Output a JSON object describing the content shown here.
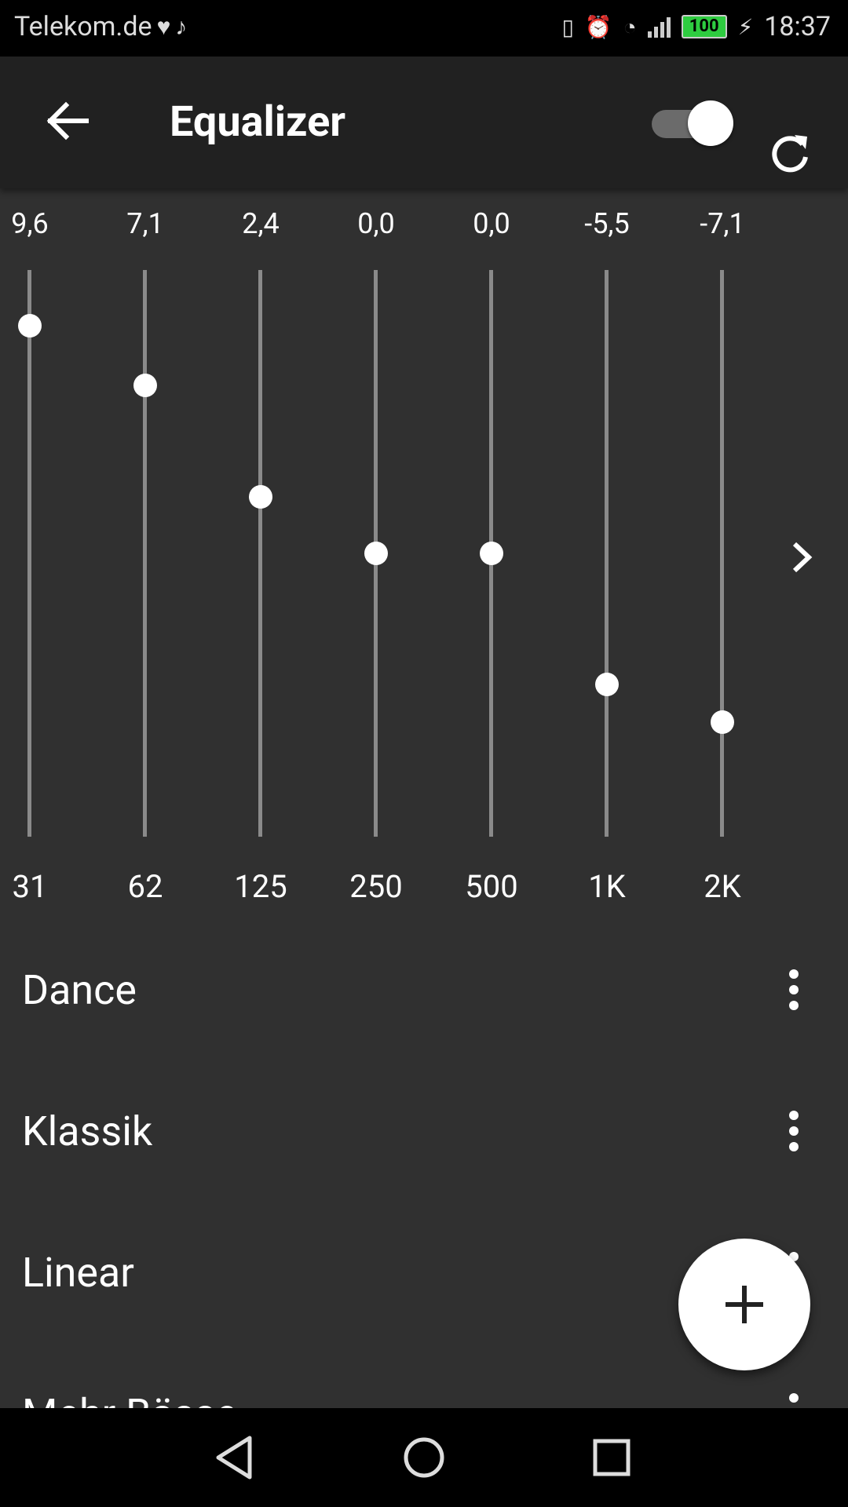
{
  "status_bar": {
    "carrier": "Telekom.de",
    "battery": "100",
    "time": "18:37"
  },
  "app_bar": {
    "title": "Equalizer",
    "toggle_on": true
  },
  "equalizer": {
    "bands": [
      {
        "value": "9,6",
        "freq": "31",
        "level": 9.6
      },
      {
        "value": "7,1",
        "freq": "62",
        "level": 7.1
      },
      {
        "value": "2,4",
        "freq": "125",
        "level": 2.4
      },
      {
        "value": "0,0",
        "freq": "250",
        "level": 0.0
      },
      {
        "value": "0,0",
        "freq": "500",
        "level": 0.0
      },
      {
        "value": "-5,5",
        "freq": "1K",
        "level": -5.5
      },
      {
        "value": "-7,1",
        "freq": "2K",
        "level": -7.1
      }
    ],
    "range": [
      -12,
      12
    ]
  },
  "presets": [
    {
      "name": "Dance"
    },
    {
      "name": "Klassik"
    },
    {
      "name": "Linear"
    },
    {
      "name": "Mehr Bässe"
    }
  ],
  "icons": {
    "back": "arrow-left-icon",
    "refresh": "refresh-icon",
    "next": "chevron-right-icon",
    "more": "more-vert-icon",
    "fab": "plus-icon"
  }
}
